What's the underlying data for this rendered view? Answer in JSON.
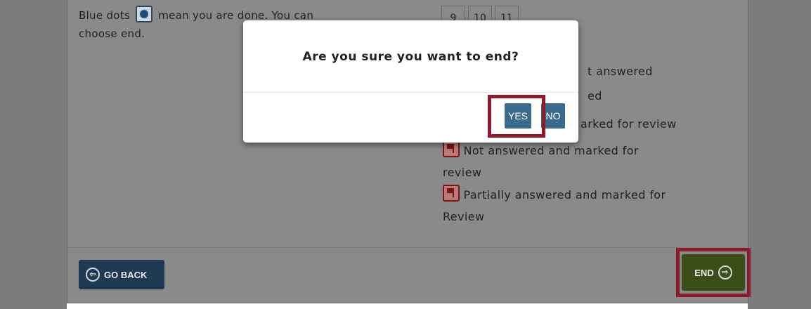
{
  "instructions": {
    "text_before_icon": "Blue dots",
    "text_after_icon": "mean you are done. You can",
    "line2": "choose end."
  },
  "question_numbers": [
    "9",
    "10",
    "11"
  ],
  "legend": {
    "item1_partial": "t answered",
    "item2_partial": "ed",
    "item3_partial": "arked for review",
    "item4_line1": "Not answered and marked for",
    "item4_line2": "review",
    "item5_line1": "Partially answered and marked for",
    "item5_line2": "Review"
  },
  "footer": {
    "back_label": "GO BACK",
    "end_label": "END"
  },
  "modal": {
    "title": "Are you sure you want to end?",
    "yes_label": "YES",
    "no_label": "NO"
  },
  "colors": {
    "highlight": "#8c1c2c",
    "modal_button": "#3a6b8c",
    "end_button": "#3c4d1a",
    "back_button": "#1f3a52"
  }
}
